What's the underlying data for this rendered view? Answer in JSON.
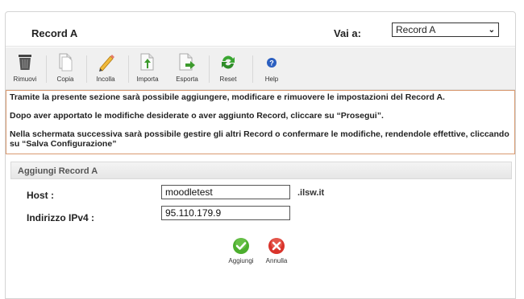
{
  "header": {
    "title": "Record A",
    "goto_label": "Vai a:",
    "goto_selected": "Record A"
  },
  "toolbar": {
    "items": [
      {
        "label": "Rimuovi",
        "icon": "trash-icon"
      },
      {
        "label": "Copia",
        "icon": "copy-icon"
      },
      {
        "label": "Incolla",
        "icon": "paste-pencil-icon"
      },
      {
        "label": "Importa",
        "icon": "import-icon"
      },
      {
        "label": "Esporta",
        "icon": "export-icon"
      },
      {
        "label": "Reset",
        "icon": "reset-icon"
      },
      {
        "label": "Help",
        "icon": "help-icon"
      }
    ]
  },
  "info": {
    "line1": "Tramite la presente sezione sarà possibile aggiungere, modificare e rimuovere le impostazioni del Record A.",
    "line2": "Dopo aver apportato le modifiche desiderate o aver aggiunto Record, cliccare su “Prosegui”.",
    "line3": "Nella schermata successiva sarà possibile gestire gli altri Record o confermare le modifiche, rendendole effettive, cliccando su “Salva Configurazione”"
  },
  "form": {
    "section_title": "Aggiungi Record A",
    "host_label": "Host :",
    "host_value": "moodletest",
    "host_suffix": ".ilsw.it",
    "ipv4_label": "Indirizzo IPv4 :",
    "ipv4_value": "95.110.179.9",
    "add_label": "Aggiungi",
    "cancel_label": "Annulla"
  },
  "colors": {
    "info_border": "#d99a70",
    "ok_green": "#4cae2e",
    "cancel_red": "#d9332b",
    "help_blue": "#2b5fc0"
  }
}
